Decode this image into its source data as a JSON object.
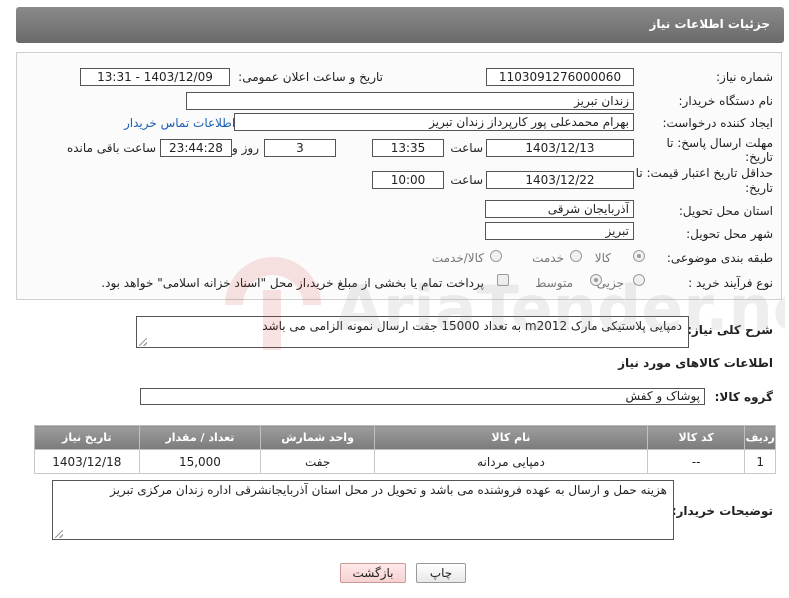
{
  "header": {
    "title": "جزئیات اطلاعات نیاز"
  },
  "form": {
    "need_number_label": "شماره نیاز:",
    "need_number": "1103091276000060",
    "announce_label": "تاریخ و ساعت اعلان عمومی:",
    "announce_value": "1403/12/09 - 13:31",
    "buyer_org_label": "نام دستگاه خریدار:",
    "buyer_org": "زندان تبریز",
    "requester_label": "ایجاد کننده درخواست:",
    "requester": "بهرام محمدعلی پور کارپرداز زندان تبریز",
    "contact_link": "اطلاعات تماس خریدار",
    "reply_deadline_label_1": "مهلت ارسال پاسخ: تا",
    "reply_deadline_label_2": "تاریخ:",
    "reply_date": "1403/12/13",
    "time_label": "ساعت",
    "reply_time": "13:35",
    "days_value": "3",
    "days_label": "روز و",
    "remaining_time": "23:44:28",
    "remaining_label": "ساعت باقی مانده",
    "price_validity_label_1": "حداقل تاریخ اعتبار قیمت: تا",
    "price_validity_label_2": "تاریخ:",
    "price_date": "1403/12/22",
    "price_time": "10:00",
    "province_label": "استان محل تحویل:",
    "province": "آذربایجان شرقی",
    "city_label": "شهر محل تحویل:",
    "city": "تبریز",
    "category_label": "طبقه بندی موضوعی:",
    "category_options": [
      "کالا",
      "خدمت",
      "کالا/خدمت"
    ],
    "process_label": "نوع فرآیند خرید :",
    "process_options": [
      "جزیی",
      "متوسط"
    ],
    "payment_note": "پرداخت تمام یا بخشی از مبلغ خرید،از محل \"اسناد خزانه اسلامی\" خواهد بود."
  },
  "summary": {
    "label": "شرح کلی نیاز:",
    "text": "دمپایی پلاستیکی مارک m2012 به تعداد 15000 جفت ارسال نمونه الزامی می باشد"
  },
  "goods_section_title": "اطلاعات کالاهای مورد نیاز",
  "goods_group": {
    "label": "گروه کالا:",
    "value": "پوشاک و کفش"
  },
  "table": {
    "headers": [
      "ردیف",
      "کد کالا",
      "نام کالا",
      "واحد شمارش",
      "تعداد / مقدار",
      "تاریخ نیاز"
    ],
    "rows": [
      [
        "1",
        "--",
        "دمپایی مردانه",
        "جفت",
        "15,000",
        "1403/12/18"
      ]
    ]
  },
  "buyer_notes": {
    "label": "توضیحات خریدار:",
    "text": "هزینه حمل و ارسال به عهده فروشنده می باشد و تحویل در محل استان آذربایجانشرقی اداره زندان مرکزی تبریز"
  },
  "buttons": {
    "print": "چاپ",
    "back": "بازگشت"
  },
  "watermark_text": "AriaTender.neT"
}
